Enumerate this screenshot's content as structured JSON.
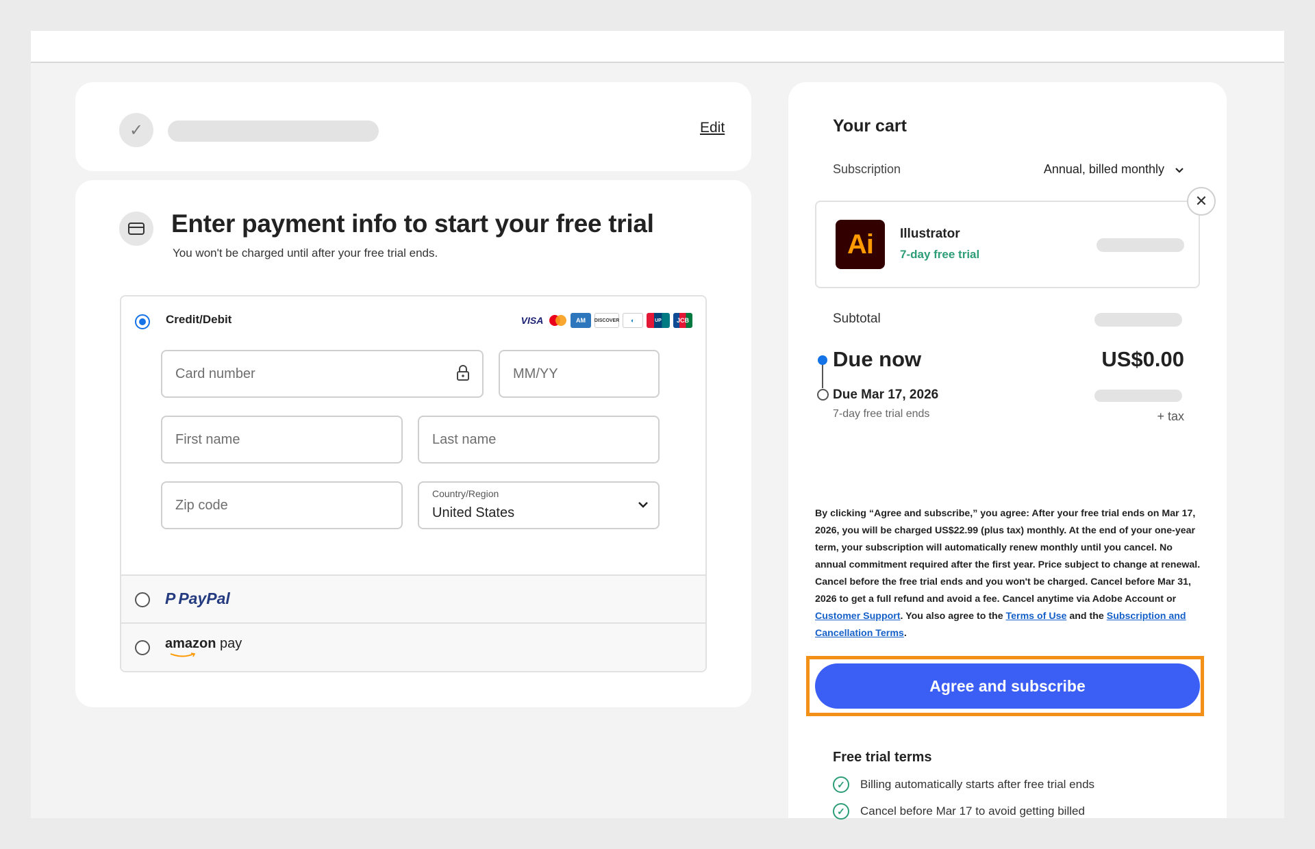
{
  "step1": {
    "edit_label": "Edit"
  },
  "payment": {
    "title": "Enter payment info to start your free trial",
    "subtitle": "You won't be charged until after your free trial ends.",
    "credit": {
      "label": "Credit/Debit",
      "card_brands": [
        "VISA",
        "Mastercard",
        "AMEX",
        "DISCOVER",
        "Diners Club",
        "UnionPay",
        "JCB"
      ],
      "card_number_placeholder": "Card number",
      "expiry_placeholder": "MM/YY",
      "first_name_placeholder": "First name",
      "last_name_placeholder": "Last name",
      "zip_placeholder": "Zip code",
      "country_label": "Country/Region",
      "country_value": "United States"
    },
    "paypal_label": "PayPal",
    "amazon_label_brand": "amazon",
    "amazon_label_pay": "pay"
  },
  "cart": {
    "title": "Your cart",
    "subscription_label": "Subscription",
    "subscription_value": "Annual, billed monthly",
    "product": {
      "logo_text": "Ai",
      "name": "Illustrator",
      "trial": "7-day free trial"
    },
    "subtotal_label": "Subtotal",
    "due_now_label": "Due now",
    "due_now_value": "US$0.00",
    "due_later_label": "Due Mar 17, 2026",
    "due_later_sub": "7-day free trial ends",
    "plus_tax": "+ tax",
    "legal": {
      "part1": "By clicking “Agree and subscribe,” you agree: After your free trial ends on Mar 17, 2026, you will be charged US$22.99 (plus tax) monthly. At the end of your one-year term, your subscription will automatically renew monthly until you cancel. No annual commitment required after the first year. Price subject to change at renewal. Cancel before the free trial ends and you won't be charged. Cancel before Mar 31, 2026 to get a full refund and avoid a fee. Cancel anytime via Adobe Account or ",
      "link_support": "Customer Support",
      "part2": ". You also agree to the ",
      "link_terms": "Terms of Use",
      "part3": " and the ",
      "link_sub_terms": "Subscription and Cancellation Terms",
      "part4": "."
    },
    "agree_button": "Agree and subscribe",
    "free_trial_terms_title": "Free trial terms",
    "terms": [
      "Billing automatically starts after free trial ends",
      "Cancel before Mar 17 to avoid getting billed"
    ]
  },
  "colors": {
    "accent_blue": "#3b5ef5",
    "radio_blue": "#1473e6",
    "trial_green": "#2d9d78",
    "highlight_orange": "#f39018"
  }
}
